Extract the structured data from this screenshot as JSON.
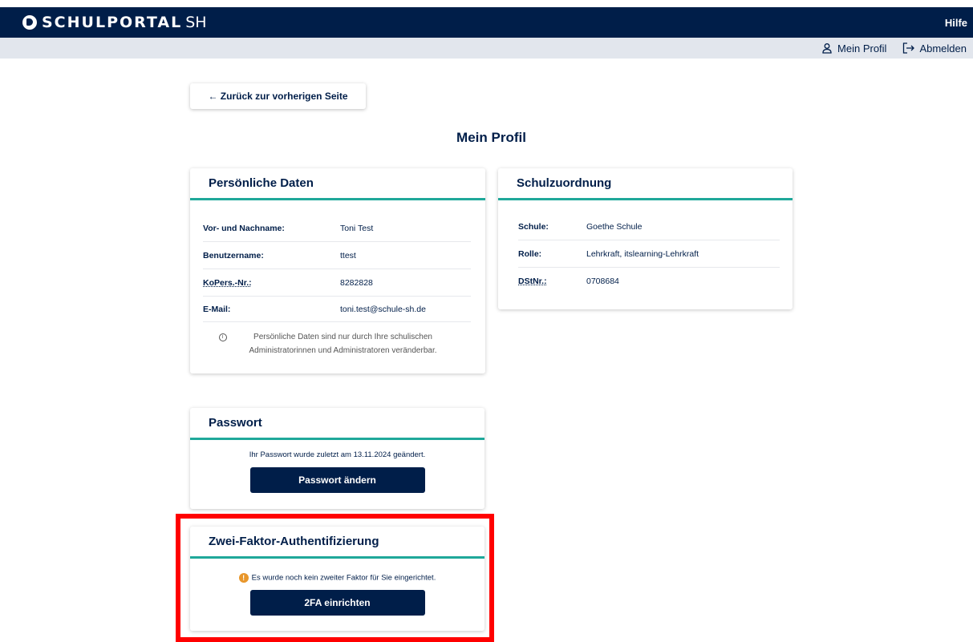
{
  "header": {
    "brand": "SCHULPORTAL",
    "brand_suffix": "SH",
    "help": "Hilfe",
    "profile": "Mein Profil",
    "logout": "Abmelden"
  },
  "back_button": "← Zurück zur vorherigen Seite",
  "page_title": "Mein Profil",
  "personal": {
    "title": "Persönliche Daten",
    "rows": [
      {
        "label": "Vor- und Nachname:",
        "value": "Toni Test"
      },
      {
        "label": "Benutzername:",
        "value": "ttest"
      },
      {
        "label": "KoPers.-Nr.:",
        "value": "8282828"
      },
      {
        "label": "E-Mail:",
        "value": "toni.test@schule-sh.de"
      }
    ],
    "note": "Persönliche Daten sind nur durch Ihre schulischen Administratorinnen und Administratoren veränderbar."
  },
  "school": {
    "title": "Schulzuordnung",
    "rows": [
      {
        "label": "Schule:",
        "value": "Goethe Schule"
      },
      {
        "label": "Rolle:",
        "value": "Lehrkraft, itslearning-Lehrkraft"
      },
      {
        "label": "DStNr.:",
        "value": "0708684"
      }
    ]
  },
  "password": {
    "title": "Passwort",
    "message": "Ihr Passwort wurde zuletzt am 13.11.2024 geändert.",
    "button": "Passwort ändern"
  },
  "twofa": {
    "title": "Zwei-Faktor-Authentifizierung",
    "message": "Es wurde noch kein zweiter Faktor für Sie eingerichtet.",
    "button": "2FA einrichten"
  },
  "colors": {
    "navy": "#001e49",
    "accent": "#1fa89a",
    "warning": "#e8962b",
    "highlight": "#ff0000"
  }
}
